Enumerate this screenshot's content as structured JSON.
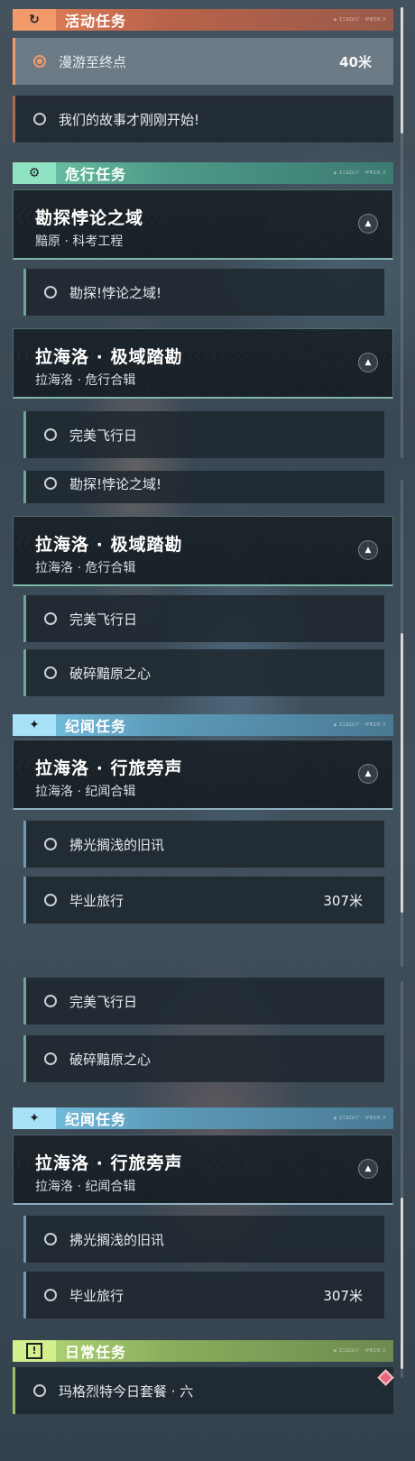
{
  "categories": {
    "active": "活动任务",
    "danger": "危行任务",
    "record": "纪闻任务",
    "daily": "日常任务",
    "deco": "◈ ΣΞΔΩΛΓ · ΨΦΣΘ Λ"
  },
  "icons": {
    "active": "↻",
    "danger": "⚙",
    "record": "✦",
    "daily": "!",
    "expand": "▲"
  },
  "quests": {
    "wander": "漫游至终点",
    "wander_dist": "40米",
    "story": "我们的故事才刚刚开始!",
    "explore_card_title": "勘探悖论之域",
    "explore_card_sub": "黯原 · 科考工程",
    "explore_row": "勘探!悖论之域!",
    "lahailuo_card_title": "拉海洛 · 极域踏勘",
    "lahailuo_card_sub": "拉海洛 · 危行合辑",
    "perfect_flight": "完美飞行日",
    "shatter": "破碎黯原之心",
    "travel_card_title": "拉海洛 · 行旅旁声",
    "travel_card_sub": "拉海洛 · 纪闻合辑",
    "old_news": "拂光搁浅的旧讯",
    "graduation": "毕业旅行",
    "graduation_dist": "307米",
    "daily_meal": "玛格烈特今日套餐 · 六"
  },
  "colors": {
    "active_accent": "#e8835a",
    "danger_accent": "#6fc9a8",
    "record_accent": "#7ac6e6",
    "daily_accent": "#b8dc78",
    "marker": "#e56a7a"
  }
}
